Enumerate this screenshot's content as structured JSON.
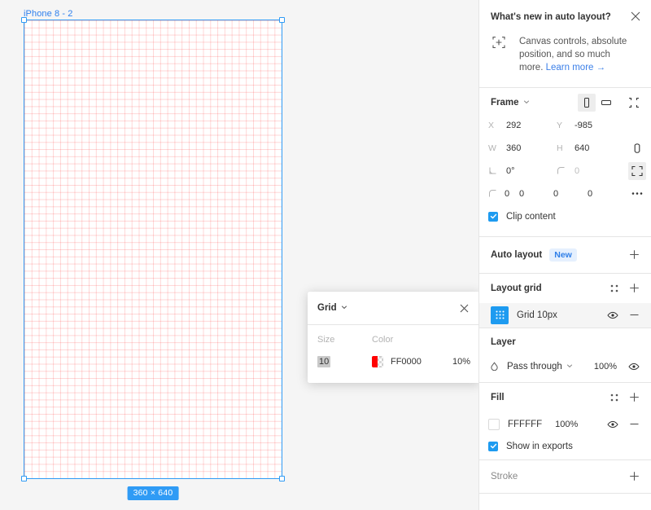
{
  "canvas": {
    "frame_label": "iPhone 8 - 2",
    "dimension_badge": "360 × 640",
    "background_color": "#F5F5F5",
    "selection_color": "#2F9BF5",
    "grid_line_color": "#FF0000",
    "grid_line_opacity": "10%"
  },
  "grid_popup": {
    "title": "Grid",
    "close_icon": "close-icon",
    "labels": {
      "size": "Size",
      "color": "Color"
    },
    "size_value": "10",
    "color_hex": "FF0000",
    "color_opacity": "10%",
    "swatch_color": "#FF0000"
  },
  "whats_new": {
    "title": "What's new in auto layout?",
    "icon": "canvas-controls-icon",
    "body": "Canvas controls, absolute position, and so much more.",
    "link": "Learn more →",
    "link_color": "#3B7FE8",
    "close_icon": "close-icon"
  },
  "frame": {
    "title": "Frame",
    "orientation_portrait_icon": "phone-portrait-icon",
    "orientation_landscape_icon": "phone-landscape-icon",
    "collapse_icon": "collapse-icon",
    "fields": {
      "x_label": "X",
      "x_value": "292",
      "y_label": "Y",
      "y_value": "-985",
      "w_label": "W",
      "w_value": "360",
      "h_label": "H",
      "h_value": "640",
      "rotation_value": "0°",
      "corner_radius_value": "0",
      "corner_tl": "0",
      "corner_tr": "0",
      "corner_br": "0",
      "corner_bl": "0"
    },
    "constrain_icon": "constrain-proportions-icon",
    "independent_corners_icon": "independent-corners-icon",
    "more_icon": "more-options-icon",
    "clip_content_label": "Clip content",
    "clip_content_checked": true
  },
  "auto_layout": {
    "title": "Auto layout",
    "badge": "New",
    "add_icon": "plus-icon"
  },
  "layout_grid": {
    "title": "Layout grid",
    "settings_icon": "grid-styles-icon",
    "add_icon": "plus-icon",
    "items": [
      {
        "icon": "layout-grid-icon",
        "label": "Grid 10px",
        "visibility_icon": "eye-icon",
        "remove_icon": "minus-icon",
        "selected": true
      }
    ]
  },
  "layer": {
    "title": "Layer",
    "blend_icon": "blend-mode-icon",
    "blend_mode": "Pass through",
    "opacity": "100%",
    "visibility_icon": "eye-icon"
  },
  "fill": {
    "title": "Fill",
    "settings_icon": "fill-styles-icon",
    "add_icon": "plus-icon",
    "items": [
      {
        "swatch_color": "#FFFFFF",
        "hex": "FFFFFF",
        "opacity": "100%",
        "visibility_icon": "eye-icon",
        "remove_icon": "minus-icon"
      }
    ],
    "show_in_exports_label": "Show in exports",
    "show_in_exports_checked": true
  },
  "stroke": {
    "title": "Stroke",
    "add_icon": "plus-icon"
  }
}
